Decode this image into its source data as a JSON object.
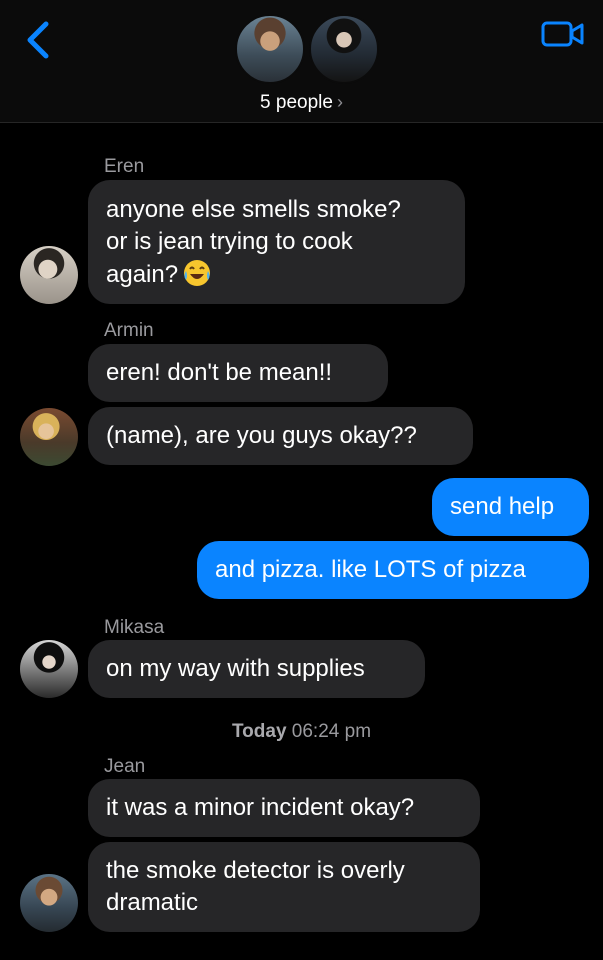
{
  "header": {
    "group_label": "5 people",
    "chevron": "›",
    "accent": "#0a84ff",
    "back_icon": "chevron-left-icon",
    "video_icon": "video-camera-icon"
  },
  "messages": [
    {
      "sender": "Eren",
      "lines": [
        "anyone else smells smoke?",
        "or is jean trying to cook",
        "again?"
      ],
      "emoji": "face-with-tears-of-joy-icon"
    },
    {
      "sender": "Armin",
      "lines": [
        "eren! don't be mean!!"
      ]
    },
    {
      "lines": [
        "(name), are you guys okay??"
      ]
    },
    {
      "outgoing": true,
      "lines": [
        "send help"
      ]
    },
    {
      "outgoing": true,
      "lines": [
        "and pizza. like LOTS of pizza"
      ]
    },
    {
      "sender": "Mikasa",
      "lines": [
        "on my way with supplies"
      ]
    },
    {
      "sender": "Jean",
      "lines": [
        "it was a minor incident okay?"
      ]
    },
    {
      "lines": [
        "the smoke detector is overly",
        "dramatic"
      ]
    }
  ],
  "timestamp": {
    "day": "Today",
    "time": "06:24 pm"
  },
  "colors": {
    "incoming_bubble": "#262628",
    "outgoing_bubble": "#0a84ff",
    "background": "#000000"
  }
}
